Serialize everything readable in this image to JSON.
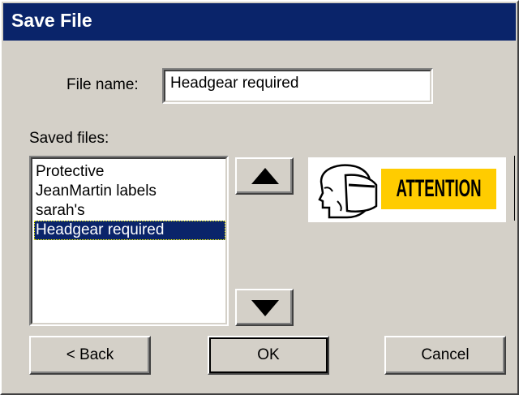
{
  "dialog": {
    "title": "Save File",
    "file_name_label": "File name:",
    "file_name_value": "Headgear required",
    "saved_files_label": "Saved files:",
    "saved_files": [
      "Protective",
      "JeanMartin labels",
      "sarah's",
      "Headgear required"
    ],
    "selected_index": 3,
    "preview_text": "ATTENTION",
    "buttons": {
      "back": "< Back",
      "ok": "OK",
      "cancel": "Cancel"
    },
    "colors": {
      "title_bar": "#0a246a",
      "selection": "#0a246a",
      "attention_bg": "#ffcc00",
      "face": "#d4d0c8"
    },
    "icons": {
      "scroll_up": "triangle-up-icon",
      "scroll_down": "triangle-down-icon",
      "preview_symbol": "face-shield-icon"
    }
  }
}
